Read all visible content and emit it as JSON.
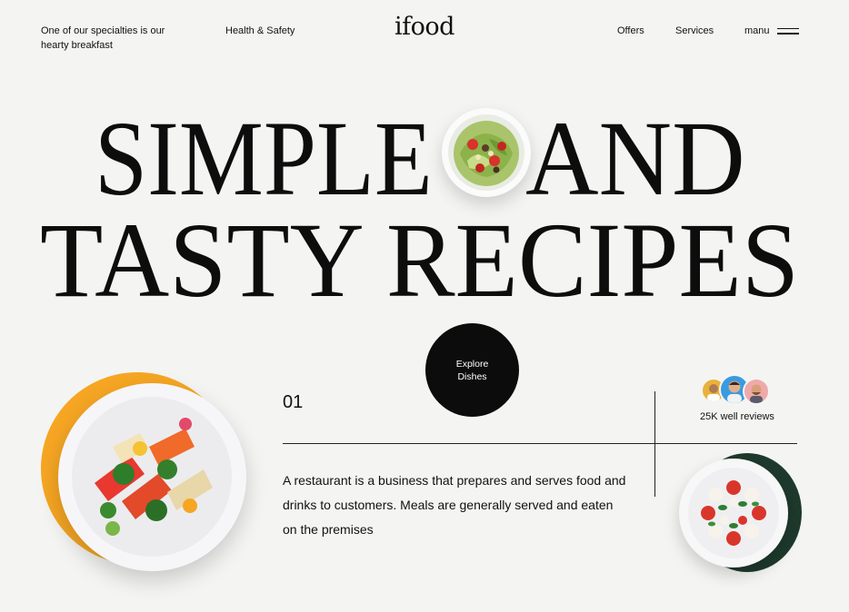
{
  "header": {
    "tagline": "One of our specialties is our hearty breakfast",
    "health_link": "Health & Safety",
    "logo": "ifood",
    "offers_link": "Offers",
    "services_link": "Services",
    "menu_label": "manu"
  },
  "hero": {
    "line1_left": "SIMPLE",
    "line1_right": "AND",
    "line2": "TASTY RECIPES"
  },
  "cta": {
    "explore_label": "Explore Dishes"
  },
  "section": {
    "number": "01",
    "description": "A restaurant is a business that prepares and serves food and drinks to customers. Meals are generally served and eaten on the premises"
  },
  "reviews": {
    "label": "25K well reviews"
  },
  "colors": {
    "background": "#f4f5f2",
    "accent_orange": "#f6a623",
    "accent_green": "#1e3a2c",
    "button": "#0c0c0c"
  },
  "icons": {
    "menu": "hamburger-icon",
    "salad": "salad-bowl-image",
    "sashimi": "sashimi-plate-image",
    "caprese": "caprese-plate-image"
  }
}
